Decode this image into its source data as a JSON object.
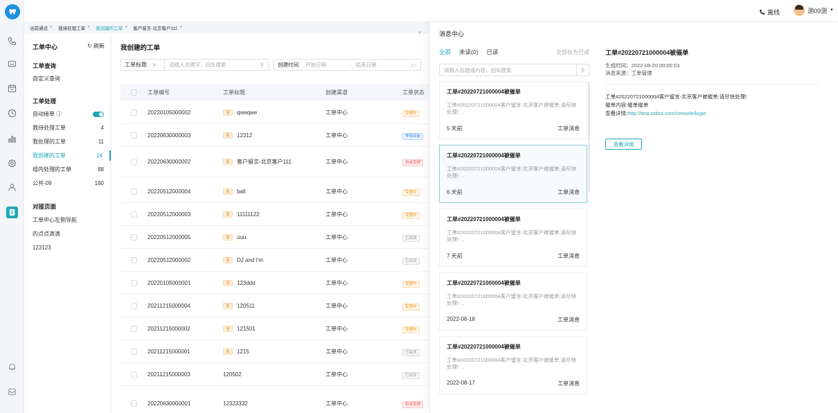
{
  "topbar": {
    "status": "离线",
    "username": "测09测"
  },
  "tabs": [
    {
      "label": "当前通话"
    },
    {
      "label": "我待处理工单"
    },
    {
      "label": "我创建的工单"
    },
    {
      "label": "客户留言-北京客户111"
    }
  ],
  "sidebar": {
    "title": "工单中心",
    "refresh": "刷新",
    "sections": {
      "query": "工单查询",
      "process": "工单处理",
      "dock": "对接页面"
    },
    "query_items": [
      {
        "label": "自定义查询"
      }
    ],
    "process_items": [
      {
        "label": "自动接单 ⓘ",
        "count": ""
      },
      {
        "label": "我待处理工单",
        "count": "4"
      },
      {
        "label": "我处理的工单",
        "count": "11"
      },
      {
        "label": "我创建的工单",
        "count": "14"
      },
      {
        "label": "组内处理的工单",
        "count": "88"
      },
      {
        "label": "公共-09",
        "count": "180"
      }
    ],
    "dock_items": [
      {
        "label": "工单中心左侧导航"
      },
      {
        "label": "的点点滴滴"
      },
      {
        "label": "123123"
      }
    ]
  },
  "main": {
    "title": "我创建的工单",
    "filter": {
      "field": "工单标题",
      "placeholder": "请输入关键字，回车搜索",
      "date_label": "创建时间:",
      "date_start": "开始日期",
      "date_sep": "-",
      "date_end": "结束日期"
    },
    "columns": [
      "工单编号",
      "工单标题",
      "创建渠道",
      "工单状态"
    ],
    "urgent_tag": "催",
    "rows": [
      {
        "id": "20220105000002",
        "title": "qweqwe",
        "urgent": true,
        "channel": "工单中心",
        "status": "受理中",
        "status_color": "orange"
      },
      {
        "id": "20220630000003",
        "title": "12312",
        "urgent": true,
        "channel": "工单中心",
        "status": "等待回复",
        "status_color": "blue"
      },
      {
        "id": "20220630000002",
        "title": "客户留言-北京客户111",
        "urgent": true,
        "channel": "工单中心",
        "status": "尚未受理",
        "status_color": "red"
      },
      {
        "id": "20220512000004",
        "title": "ball",
        "urgent": true,
        "channel": "工单中心",
        "status": "受理中",
        "status_color": "orange"
      },
      {
        "id": "20220512000003",
        "title": "11111122",
        "urgent": true,
        "channel": "工单中心",
        "status": "受理中",
        "status_color": "orange"
      },
      {
        "id": "20220512000005",
        "title": "uuu",
        "urgent": true,
        "channel": "工单中心",
        "status": "已关闭",
        "status_color": "grey"
      },
      {
        "id": "20220512000002",
        "title": "DJ and I'm",
        "urgent": true,
        "channel": "工单中心",
        "status": "已关闭",
        "status_color": "grey"
      },
      {
        "id": "20220105000001",
        "title": "123ddd",
        "urgent": true,
        "channel": "工单中心",
        "status": "受理中",
        "status_color": "orange"
      },
      {
        "id": "20211215000004",
        "title": "120511",
        "urgent": true,
        "channel": "工单中心",
        "status": "受理中",
        "status_color": "orange"
      },
      {
        "id": "20211215000002",
        "title": "121501",
        "urgent": true,
        "channel": "工单中心",
        "status": "受理中",
        "status_color": "orange"
      },
      {
        "id": "20211215000001",
        "title": "1215",
        "urgent": true,
        "channel": "工单中心",
        "status": "已关闭",
        "status_color": "grey"
      },
      {
        "id": "20211215000003",
        "title": "120502",
        "urgent": false,
        "channel": "工单中心",
        "status": "已关闭",
        "status_color": "grey"
      },
      {
        "id": "20220630000001",
        "title": "12323332",
        "urgent": false,
        "channel": "工单中心",
        "status": "尚未受理",
        "status_color": "red"
      }
    ]
  },
  "message_center": {
    "title": "消息中心",
    "tabs": [
      {
        "label": "全部",
        "active": true
      },
      {
        "label": "未读(0)",
        "active": false
      },
      {
        "label": "已读",
        "active": false
      }
    ],
    "mark_all": "全部标为已读",
    "search_placeholder": "请输入标题或内容，回车搜索",
    "cards": [
      {
        "title": "工单#20220721000004被催单",
        "body": "工单#20220721000004客户留言-北京客户被催单,请尽快处理! ...",
        "time": "5 天前",
        "type": "工单消息",
        "selected": false
      },
      {
        "title": "工单#20220721000004被催单",
        "body": "工单#20220721000004客户留言-北京客户被催单,请尽快处理! ...",
        "time": "6 天前",
        "type": "工单消息",
        "selected": true
      },
      {
        "title": "工单#20220721000004被催单",
        "body": "工单#20220721000004客户留言-北京客户被催单,请尽快处理! ...",
        "time": "7 天前",
        "type": "工单消息",
        "selected": false
      },
      {
        "title": "工单#20220721000004被催单",
        "body": "工单#20220721000004客户留言-北京客户被催单,请尽快处理! ...",
        "time": "2022-08-18",
        "type": "工单消息",
        "selected": false
      },
      {
        "title": "工单#20220721000004被催单",
        "body": "工单#20220721000004客户留言-北京客户被催单,请尽快处理! ...",
        "time": "2022-08-17",
        "type": "工单消息",
        "selected": false
      }
    ],
    "detail": {
      "title": "工单#20220721000004被催单",
      "generated": "生成时间：2022-08-20 00:00:03",
      "source": "消息来源：工单管理",
      "line1": "工单#20220721000004客户留言-北京客户被催单,请尽快处理!",
      "line2": "催单内容:催单催单",
      "line3_prefix": "查看详情:",
      "line3_link": "http://test.sobot.com/console/login",
      "button": "查看详情"
    }
  },
  "colors": {
    "accent": "#20a7b5",
    "brand": "#1d8fe0"
  }
}
